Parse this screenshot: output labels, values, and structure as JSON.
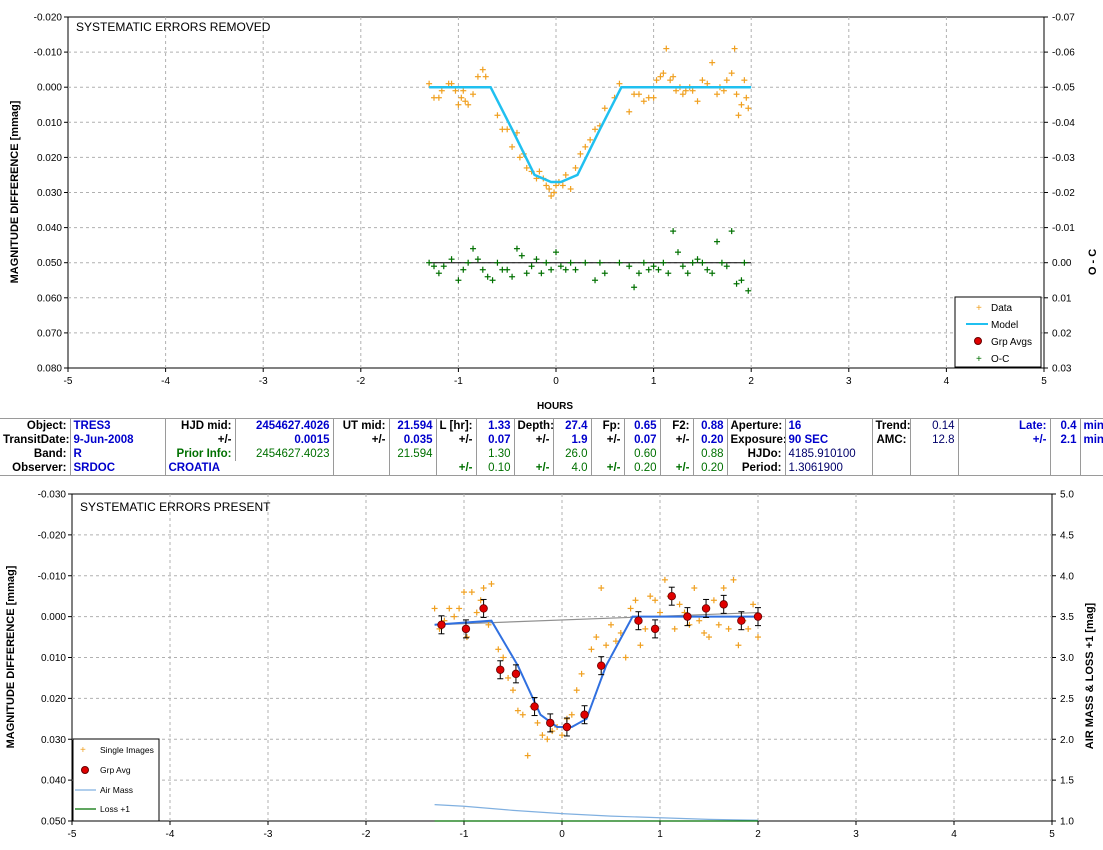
{
  "top_chart": {
    "title": "SYSTEMATIC ERRORS REMOVED",
    "ylabel_left": "MAGNITUDE DIFFERENCE [mmag]",
    "ylabel_right": "O - C",
    "xlabel": "HOURS",
    "x_ticks": [
      "-5",
      "-4",
      "-3",
      "-2",
      "-1",
      "0",
      "1",
      "2",
      "3",
      "4",
      "5"
    ],
    "y_left_ticks": [
      "-0.020",
      "-0.010",
      "0.000",
      "0.010",
      "0.020",
      "0.030",
      "0.040",
      "0.050",
      "0.060",
      "0.070",
      "0.080"
    ],
    "y_right_ticks": [
      "-0.07",
      "-0.06",
      "-0.05",
      "-0.04",
      "-0.03",
      "-0.02",
      "-0.01",
      "0.00",
      "0.01",
      "0.02",
      "0.03"
    ],
    "legend": [
      "Data",
      "Model",
      "Grp Avgs",
      "O-C"
    ],
    "colors": {
      "data": "#f0a020",
      "model": "#20c0f0",
      "grp": "#e00000",
      "oc": "#007000",
      "axis": "#000000",
      "grid": "#b0b0b0"
    }
  },
  "info": {
    "object_label": "Object:",
    "object": "TRES3",
    "transit_label": "TransitDate:",
    "transit": "9-Jun-2008",
    "band_label": "Band:",
    "band": "R",
    "observer_label": "Observer:",
    "observer": "SRDOC",
    "location": "CROATIA",
    "hjd_label": "HJD mid:",
    "hjd": "2454627.4026",
    "pm": "+/-",
    "hjd_err": "0.0015",
    "prior_label": "Prior Info:",
    "prior_hjd": "2454627.4023",
    "ut_label": "UT mid:",
    "ut": "21.594",
    "ut_err": "0.035",
    "prior_ut": "21.594",
    "l_label": "L [hr]:",
    "l": "1.33",
    "l_err": "0.07",
    "prior_l": "1.30",
    "l_err2": "0.10",
    "depth_label": "Depth:",
    "depth": "27.4",
    "depth_err": "1.9",
    "prior_depth": "26.0",
    "depth_err2": "4.0",
    "fp_label": "Fp:",
    "fp": "0.65",
    "fp_err": "0.07",
    "prior_fp": "0.60",
    "fp_err2": "0.20",
    "f2_label": "F2:",
    "f2": "0.88",
    "f2_err": "0.20",
    "prior_f2": "0.88",
    "f2_err2": "0.20",
    "aperture_label": "Aperture:",
    "aperture": "16",
    "exposure_label": "Exposure:",
    "exposure": "90 SEC",
    "hjdo_label": "HJDo:",
    "hjdo": "4185.910100",
    "period_label": "Period:",
    "period": "1.3061900",
    "trend_label": "Trend:",
    "trend": "0.14",
    "amc_label": "AMC:",
    "amc": "12.8",
    "late_label": "Late:",
    "late": "0.4",
    "late_unit": "min",
    "late_err": "2.1",
    "late_err_unit": "min"
  },
  "bottom_chart": {
    "title": "SYSTEMATIC ERRORS PRESENT",
    "ylabel_left": "MAGNITUDE DIFFERENCE [mmag]",
    "ylabel_right": "AIR MASS & LOSS +1 [mag]",
    "x_ticks": [
      "-5",
      "-4",
      "-3",
      "-2",
      "-1",
      "0",
      "1",
      "2",
      "3",
      "4",
      "5"
    ],
    "y_left_ticks": [
      "-0.030",
      "-0.020",
      "-0.010",
      "0.000",
      "0.010",
      "0.020",
      "0.030",
      "0.040",
      "0.050"
    ],
    "y_right_ticks": [
      "5.0",
      "4.5",
      "4.0",
      "3.5",
      "3.0",
      "2.5",
      "2.0",
      "1.5",
      "1.0"
    ],
    "legend": [
      "Single Images",
      "Grp Avg",
      "Air Mass",
      "Loss +1"
    ],
    "colors": {
      "data": "#f0a020",
      "model": "#3070e0",
      "grp": "#e00000",
      "airmass": "#80b0e0",
      "loss": "#007000",
      "trend": "#909090"
    }
  },
  "chart_data": [
    {
      "type": "scatter",
      "title": "SYSTEMATIC ERRORS REMOVED",
      "xlabel": "HOURS",
      "ylabel": "MAGNITUDE DIFFERENCE [mmag]",
      "xlim": [
        -5,
        5
      ],
      "ylim": [
        -0.02,
        0.08
      ],
      "y_inverted": true,
      "y2label": "O - C",
      "y2lim": [
        -0.07,
        0.03
      ],
      "legend_position": "bottom-right",
      "series": [
        {
          "name": "Data",
          "x": [
            -1.3,
            -1.25,
            -1.2,
            -1.17,
            -1.1,
            -1.07,
            -1.03,
            -1.0,
            -0.97,
            -0.95,
            -0.93,
            -0.9,
            -0.85,
            -0.8,
            -0.75,
            -0.72,
            -0.6,
            -0.55,
            -0.5,
            -0.45,
            -0.4,
            -0.37,
            -0.33,
            -0.3,
            -0.25,
            -0.2,
            -0.17,
            -0.13,
            -0.1,
            -0.07,
            -0.05,
            -0.02,
            0.0,
            0.03,
            0.07,
            0.1,
            0.15,
            0.2,
            0.25,
            0.3,
            0.35,
            0.4,
            0.45,
            0.5,
            0.6,
            0.65,
            0.75,
            0.8,
            0.85,
            0.9,
            0.95,
            1.0,
            1.03,
            1.07,
            1.1,
            1.13,
            1.17,
            1.2,
            1.23,
            1.27,
            1.3,
            1.33,
            1.37,
            1.4,
            1.45,
            1.5,
            1.55,
            1.6,
            1.65,
            1.68,
            1.72,
            1.75,
            1.8,
            1.83,
            1.85,
            1.87,
            1.9,
            1.93,
            1.95,
            1.97
          ],
          "y": [
            -0.001,
            0.003,
            0.003,
            0.001,
            -0.001,
            -0.001,
            0.001,
            0.005,
            0.003,
            0.001,
            0.004,
            0.005,
            0.002,
            -0.003,
            -0.005,
            -0.003,
            0.008,
            0.012,
            0.012,
            0.017,
            0.013,
            0.02,
            0.019,
            0.023,
            0.024,
            0.026,
            0.024,
            0.026,
            0.028,
            0.029,
            0.031,
            0.03,
            0.028,
            0.027,
            0.028,
            0.025,
            0.029,
            0.023,
            0.019,
            0.017,
            0.015,
            0.012,
            0.011,
            0.006,
            0.003,
            -0.001,
            0.007,
            0.002,
            0.002,
            0.004,
            0.003,
            0.003,
            -0.002,
            -0.003,
            -0.004,
            -0.011,
            -0.002,
            -0.003,
            0.001,
            0.0,
            0.002,
            0.001,
            0.0,
            0.001,
            0.004,
            -0.002,
            -0.001,
            -0.007,
            0.002,
            0.0,
            0.001,
            -0.002,
            -0.004,
            -0.011,
            0.002,
            0.008,
            0.005,
            -0.002,
            0.003,
            0.006
          ]
        },
        {
          "name": "Model",
          "x": [
            -1.3,
            -0.67,
            -0.45,
            -0.22,
            -0.05,
            0.05,
            0.22,
            0.45,
            0.67,
            2.0
          ],
          "y": [
            0.0,
            0.0,
            0.012,
            0.025,
            0.027,
            0.027,
            0.025,
            0.012,
            0.0,
            0.0
          ]
        },
        {
          "name": "O-C",
          "x": [
            -1.3,
            -1.25,
            -1.2,
            -1.15,
            -1.07,
            -1.0,
            -0.95,
            -0.9,
            -0.85,
            -0.8,
            -0.75,
            -0.7,
            -0.65,
            -0.6,
            -0.55,
            -0.5,
            -0.45,
            -0.4,
            -0.35,
            -0.3,
            -0.25,
            -0.2,
            -0.15,
            -0.1,
            -0.05,
            0.0,
            0.05,
            0.1,
            0.15,
            0.2,
            0.3,
            0.4,
            0.45,
            0.5,
            0.65,
            0.75,
            0.8,
            0.85,
            0.9,
            0.95,
            1.0,
            1.05,
            1.1,
            1.15,
            1.2,
            1.25,
            1.3,
            1.35,
            1.4,
            1.45,
            1.5,
            1.55,
            1.6,
            1.65,
            1.7,
            1.75,
            1.8,
            1.85,
            1.9,
            1.93,
            1.97
          ],
          "y": [
            0.0,
            0.001,
            0.003,
            0.001,
            -0.001,
            0.005,
            0.002,
            0.0,
            -0.004,
            -0.001,
            0.002,
            0.004,
            0.005,
            0.0,
            0.002,
            0.002,
            0.004,
            -0.004,
            -0.002,
            0.003,
            0.001,
            -0.001,
            0.003,
            0.0,
            0.002,
            -0.003,
            0.001,
            0.002,
            0.0,
            0.002,
            0.0,
            0.005,
            0.0,
            0.003,
            0.0,
            0.001,
            0.007,
            0.003,
            0.0,
            0.002,
            0.001,
            0.002,
            0.0,
            0.003,
            -0.009,
            -0.003,
            0.001,
            0.003,
            0.0,
            -0.001,
            0.0,
            0.002,
            0.003,
            -0.006,
            0.0,
            0.001,
            -0.009,
            0.006,
            0.005,
            0.0,
            0.008
          ]
        }
      ]
    },
    {
      "type": "scatter",
      "title": "SYSTEMATIC ERRORS PRESENT",
      "ylabel": "MAGNITUDE DIFFERENCE [mmag]",
      "xlim": [
        -5,
        5
      ],
      "ylim": [
        -0.03,
        0.05
      ],
      "y_inverted": true,
      "y2label": "AIR MASS & LOSS +1 [mag]",
      "y2lim": [
        1.0,
        5.0
      ],
      "legend_position": "bottom-left",
      "series": [
        {
          "name": "Single Images",
          "x": [
            -1.3,
            -1.25,
            -1.2,
            -1.15,
            -1.1,
            -1.05,
            -1.0,
            -0.97,
            -0.92,
            -0.87,
            -0.83,
            -0.8,
            -0.75,
            -0.72,
            -0.65,
            -0.6,
            -0.55,
            -0.5,
            -0.45,
            -0.4,
            -0.35,
            -0.3,
            -0.25,
            -0.2,
            -0.15,
            -0.1,
            -0.05,
            0.0,
            0.05,
            0.1,
            0.15,
            0.2,
            0.3,
            0.35,
            0.4,
            0.45,
            0.5,
            0.55,
            0.6,
            0.65,
            0.7,
            0.75,
            0.8,
            0.85,
            0.9,
            0.95,
            1.0,
            1.05,
            1.1,
            1.15,
            1.2,
            1.25,
            1.3,
            1.35,
            1.4,
            1.45,
            1.5,
            1.55,
            1.6,
            1.65,
            1.7,
            1.75,
            1.8,
            1.85,
            1.9,
            1.95,
            2.0
          ],
          "y": [
            -0.002,
            0.003,
            0.001,
            -0.002,
            0.0,
            -0.002,
            -0.006,
            0.005,
            -0.006,
            -0.001,
            -0.004,
            -0.007,
            0.002,
            -0.008,
            0.008,
            0.01,
            0.015,
            0.018,
            0.023,
            0.024,
            0.034,
            0.022,
            0.026,
            0.029,
            0.03,
            0.028,
            0.027,
            0.029,
            0.025,
            0.024,
            0.018,
            0.014,
            0.008,
            0.005,
            -0.007,
            0.007,
            0.002,
            0.006,
            0.004,
            0.01,
            -0.002,
            -0.004,
            0.007,
            0.003,
            -0.005,
            -0.004,
            -0.001,
            -0.009,
            -0.005,
            0.003,
            -0.003,
            -0.001,
            0.002,
            -0.007,
            0.001,
            0.004,
            0.005,
            -0.004,
            0.002,
            -0.007,
            0.003,
            -0.009,
            0.007,
            0.001,
            0.003,
            -0.003,
            0.005
          ]
        },
        {
          "name": "Grp Avg",
          "x": [
            -1.23,
            -0.98,
            -0.8,
            -0.63,
            -0.47,
            -0.28,
            -0.12,
            0.05,
            0.23,
            0.4,
            0.78,
            0.95,
            1.12,
            1.28,
            1.47,
            1.65,
            1.83,
            2.0
          ],
          "y": [
            0.002,
            0.003,
            -0.002,
            0.013,
            0.014,
            0.022,
            0.026,
            0.027,
            0.024,
            0.012,
            0.001,
            0.003,
            -0.005,
            0.0,
            -0.002,
            -0.003,
            0.001,
            0.0
          ]
        },
        {
          "name": "Model",
          "x": [
            -1.3,
            -0.72,
            -0.45,
            -0.22,
            -0.05,
            0.1,
            0.25,
            0.45,
            0.72,
            2.0
          ],
          "y": [
            0.002,
            0.001,
            0.012,
            0.024,
            0.027,
            0.027,
            0.025,
            0.012,
            0.0,
            0.0
          ]
        },
        {
          "name": "Air Mass",
          "x": [
            -1.3,
            -1.0,
            -0.5,
            0.0,
            0.5,
            1.0,
            1.5,
            2.0
          ],
          "y2": [
            1.2,
            1.18,
            1.13,
            1.09,
            1.06,
            1.04,
            1.02,
            1.01
          ]
        },
        {
          "name": "Loss +1",
          "x": [
            -1.3,
            2.0
          ],
          "y2": [
            1.0,
            1.0
          ]
        }
      ]
    }
  ]
}
